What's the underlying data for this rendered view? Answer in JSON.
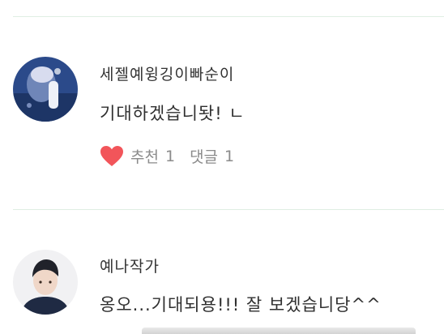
{
  "comments": [
    {
      "author": "세젤예윙깅이빠순이",
      "text": "기대하겠습니돳! ㄴ",
      "actions": {
        "like_label": "추천",
        "like_count": "1",
        "reply_label": "댓글",
        "reply_count": "1"
      },
      "icons": {
        "like": "heart-icon",
        "avatar": "profile-photo"
      },
      "colors": {
        "heart": "#f2555a"
      }
    },
    {
      "author": "예나작가",
      "text": "옹오...기대되용!!! 잘 보겠습니당^^",
      "icons": {
        "avatar": "profile-photo"
      }
    }
  ],
  "colors": {
    "divider": "#dfeee3",
    "action_text": "#8b8b8b",
    "text": "#2f2f2f"
  }
}
